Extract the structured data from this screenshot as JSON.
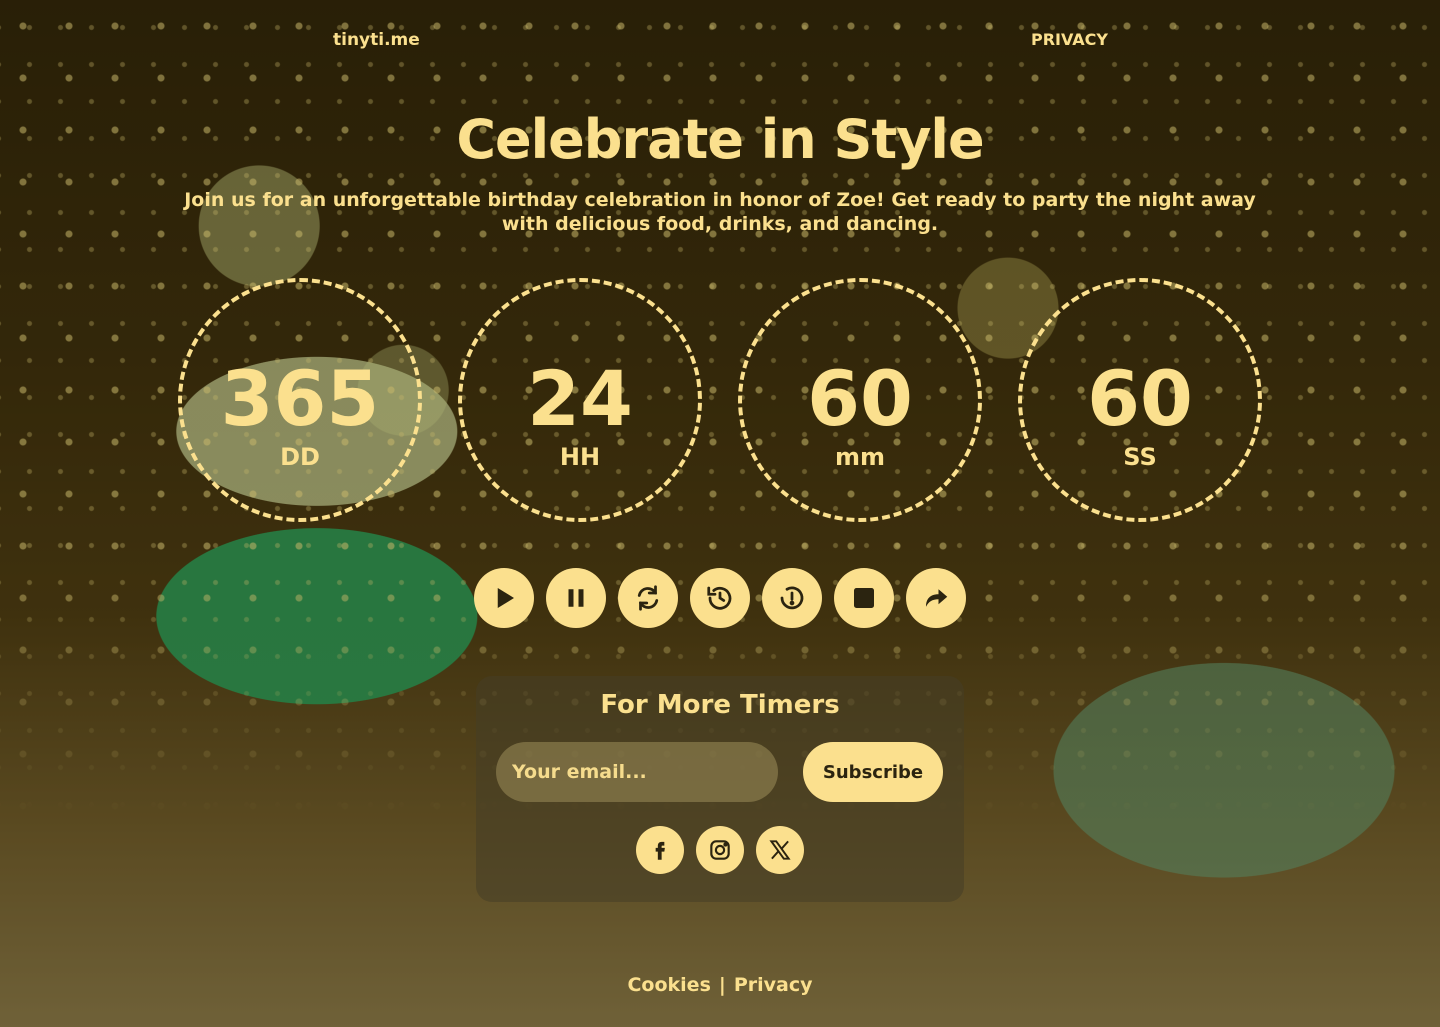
{
  "header": {
    "brand": "tinyti.me",
    "privacy": "PRIVACY"
  },
  "hero": {
    "title": "Celebrate in Style",
    "subtitle": "Join us for an unforgettable birthday celebration in honor of Zoe! Get ready to party the night away with delicious food, drinks, and dancing."
  },
  "countdown": [
    {
      "value": "365",
      "label": "DD"
    },
    {
      "value": "24",
      "label": "HH"
    },
    {
      "value": "60",
      "label": "mm"
    },
    {
      "value": "60",
      "label": "SS"
    }
  ],
  "controls": [
    "play-icon",
    "pause-icon",
    "refresh-icon",
    "history-icon",
    "timer-reset-icon",
    "stop-icon",
    "share-icon"
  ],
  "subscribe": {
    "title": "For More Timers",
    "email_placeholder": "Your email...",
    "button": "Subscribe"
  },
  "socials": [
    "facebook-icon",
    "instagram-icon",
    "x-icon"
  ],
  "footer": {
    "cookies": "Cookies",
    "separator": "|",
    "privacy": "Privacy"
  },
  "colors": {
    "accent": "#fbe08e",
    "dark": "#2b2410"
  }
}
